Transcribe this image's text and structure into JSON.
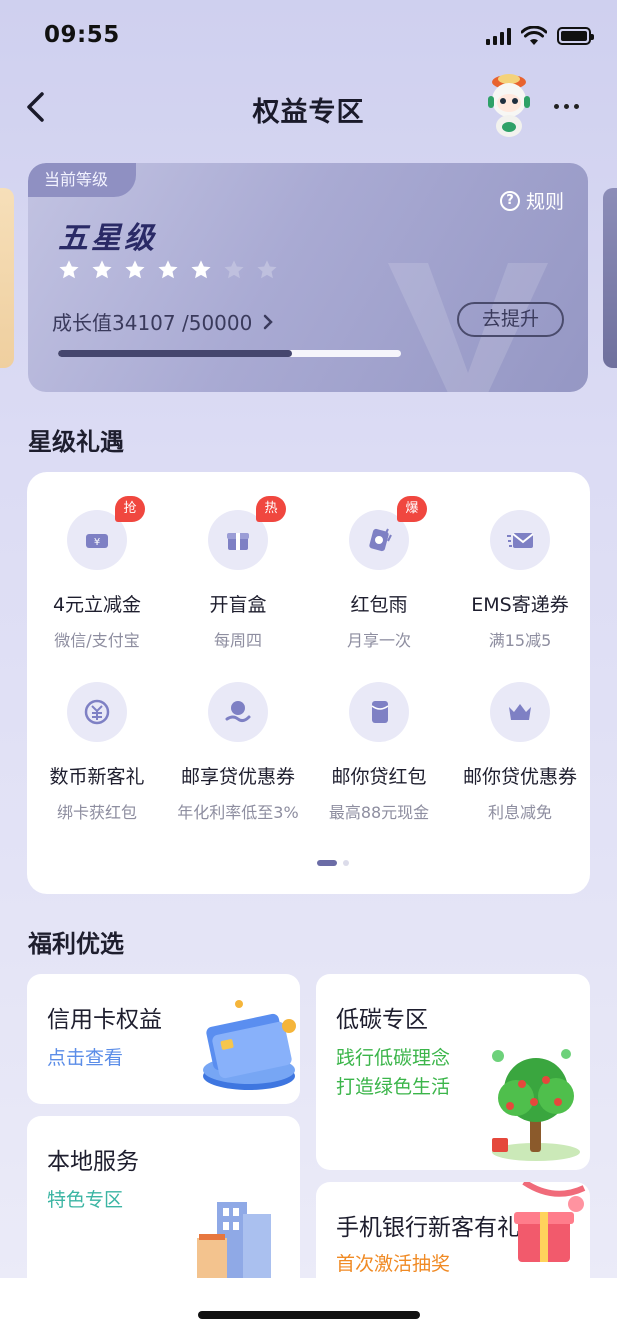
{
  "status_bar": {
    "time": "09:55"
  },
  "nav": {
    "title": "权益专区"
  },
  "level_card": {
    "tag": "当前等级",
    "level_name": "五星级",
    "stars_filled": 5,
    "stars_total": 7,
    "rule_label": "规则",
    "growth_text": "成长值34107 /50000",
    "growth_value": 34107,
    "growth_max": 50000,
    "upgrade_label": "去提升"
  },
  "section_benefits": {
    "title": "星级礼遇"
  },
  "benefits": [
    {
      "label": "4元立减金",
      "sub": "微信/支付宝",
      "badge": "抢",
      "icon": "voucher-icon"
    },
    {
      "label": "开盲盒",
      "sub": "每周四",
      "badge": "热",
      "icon": "gift-box-icon"
    },
    {
      "label": "红包雨",
      "sub": "月享一次",
      "badge": "爆",
      "icon": "red-envelope-rain-icon"
    },
    {
      "label": "EMS寄递券",
      "sub": "满15减5",
      "badge": "",
      "icon": "mail-icon"
    },
    {
      "label": "数币新客礼",
      "sub": "绑卡获红包",
      "badge": "",
      "icon": "digital-currency-icon"
    },
    {
      "label": "邮享贷优惠券",
      "sub": "年化利率低至3%",
      "badge": "",
      "icon": "loan-hand-icon"
    },
    {
      "label": "邮你贷红包",
      "sub": "最高88元现金",
      "badge": "",
      "icon": "red-packet-icon"
    },
    {
      "label": "邮你贷优惠券",
      "sub": "利息减免",
      "badge": "",
      "icon": "crown-icon"
    }
  ],
  "section_welfare": {
    "title": "福利优选"
  },
  "welfare": {
    "credit_card": {
      "title": "信用卡权益",
      "sub": "点击查看"
    },
    "low_carbon": {
      "title": "低碳专区",
      "sub_line1": "践行低碳理念",
      "sub_line2": "打造绿色生活"
    },
    "local_service": {
      "title": "本地服务",
      "sub": "特色专区"
    },
    "new_customer": {
      "title": "手机银行新客有礼",
      "sub": "首次激活抽奖"
    }
  },
  "colors": {
    "accent": "#6b6ca6",
    "badge_red": "#f0473f",
    "link_blue": "#5b8de8",
    "green": "#3bb54a",
    "orange": "#f08a24"
  }
}
